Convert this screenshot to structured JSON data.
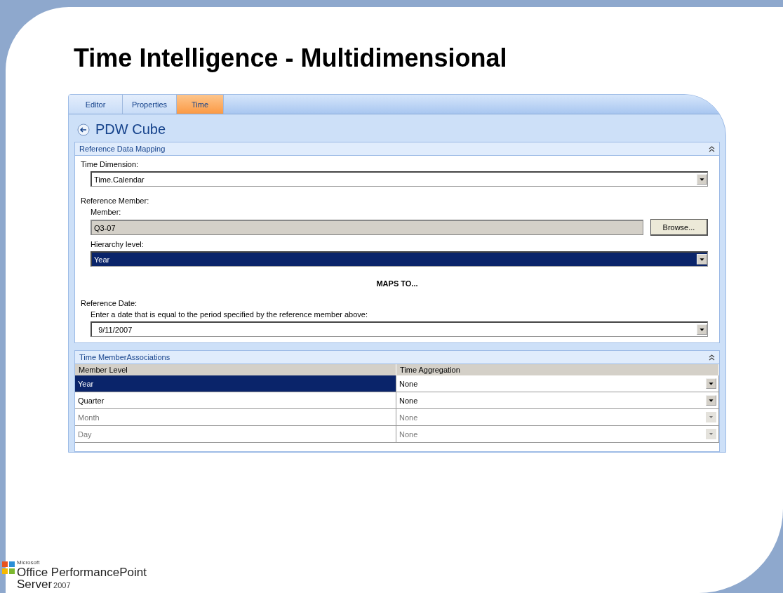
{
  "slide_title": "Time Intelligence - Multidimensional",
  "tabs": [
    {
      "label": "Editor",
      "selected": false
    },
    {
      "label": "Properties",
      "selected": false
    },
    {
      "label": "Time",
      "selected": true
    }
  ],
  "heading": "PDW Cube",
  "mapping": {
    "title": "Reference Data Mapping",
    "time_dimension": {
      "label": "Time Dimension:",
      "value": "Time.Calendar"
    },
    "reference_member_label": "Reference Member:",
    "member": {
      "label": "Member:",
      "value": "Q3-07",
      "button": "Browse..."
    },
    "hierarchy": {
      "label": "Hierarchy  level:",
      "value": "Year",
      "highlighted": true
    },
    "maps_to": "MAPS TO...",
    "reference_date_label": "Reference Date:",
    "date": {
      "label": "Enter a date that is equal to the period specified by the reference member above:",
      "value": "9/11/2007"
    }
  },
  "associations": {
    "title": "Time MemberAssociations",
    "columns": [
      "Member Level",
      "Time Aggregation"
    ],
    "rows": [
      {
        "level": "Year",
        "aggregation": "None",
        "selected": true,
        "disabled": false
      },
      {
        "level": "Quarter",
        "aggregation": "None",
        "selected": false,
        "disabled": false
      },
      {
        "level": "Month",
        "aggregation": "None",
        "selected": false,
        "disabled": true
      },
      {
        "level": "Day",
        "aggregation": "None",
        "selected": false,
        "disabled": true
      }
    ]
  },
  "logo": {
    "vendor": "Microsoft",
    "product": "Office PerformancePoint",
    "line2": "Server",
    "year": "2007"
  }
}
